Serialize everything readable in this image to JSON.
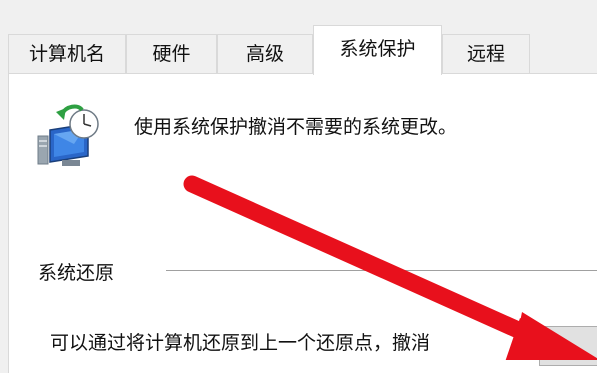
{
  "tabs": [
    {
      "label": "计算机名"
    },
    {
      "label": "硬件"
    },
    {
      "label": "高级"
    },
    {
      "label": "系统保护"
    },
    {
      "label": "远程"
    }
  ],
  "active_tab": "系统保护",
  "header": {
    "icon": "system-protection-icon",
    "description": "使用系统保护撤消不需要的系统更改。"
  },
  "restore_group": {
    "label": "系统还原",
    "text": "可以通过将计算机还原到上一个还原点，撤消"
  },
  "annotation": {
    "type": "red-arrow",
    "color": "#e8101c"
  }
}
